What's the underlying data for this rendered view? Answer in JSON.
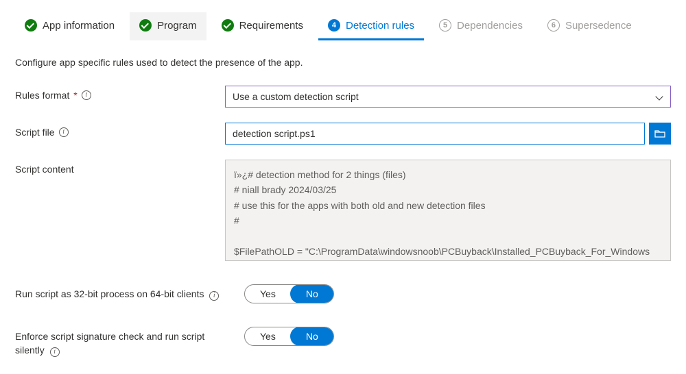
{
  "tabs": [
    {
      "label": "App information",
      "state": "done"
    },
    {
      "label": "Program",
      "state": "done"
    },
    {
      "label": "Requirements",
      "state": "done"
    },
    {
      "label": "Detection rules",
      "state": "current",
      "number": "4"
    },
    {
      "label": "Dependencies",
      "state": "disabled",
      "number": "5"
    },
    {
      "label": "Supersedence",
      "state": "disabled",
      "number": "6"
    }
  ],
  "description": "Configure app specific rules used to detect the presence of the app.",
  "labels": {
    "rules_format": "Rules format",
    "script_file": "Script file",
    "script_content": "Script content",
    "run_32bit": "Run script as 32-bit process on 64-bit clients",
    "enforce_sig": "Enforce script signature check and run script silently"
  },
  "values": {
    "rules_format_selected": "Use a custom detection script",
    "script_file_name": "detection script.ps1",
    "script_content_text": "ï»¿# detection method for 2 things (files)\n# niall brady 2024/03/25\n# use this for the apps with both old and new detection files\n#\n\n$FilePathOLD = \"C:\\ProgramData\\windowsnoob\\PCBuyback\\Installed_PCBuyback_For_Windows"
  },
  "toggle": {
    "yes": "Yes",
    "no": "No"
  }
}
